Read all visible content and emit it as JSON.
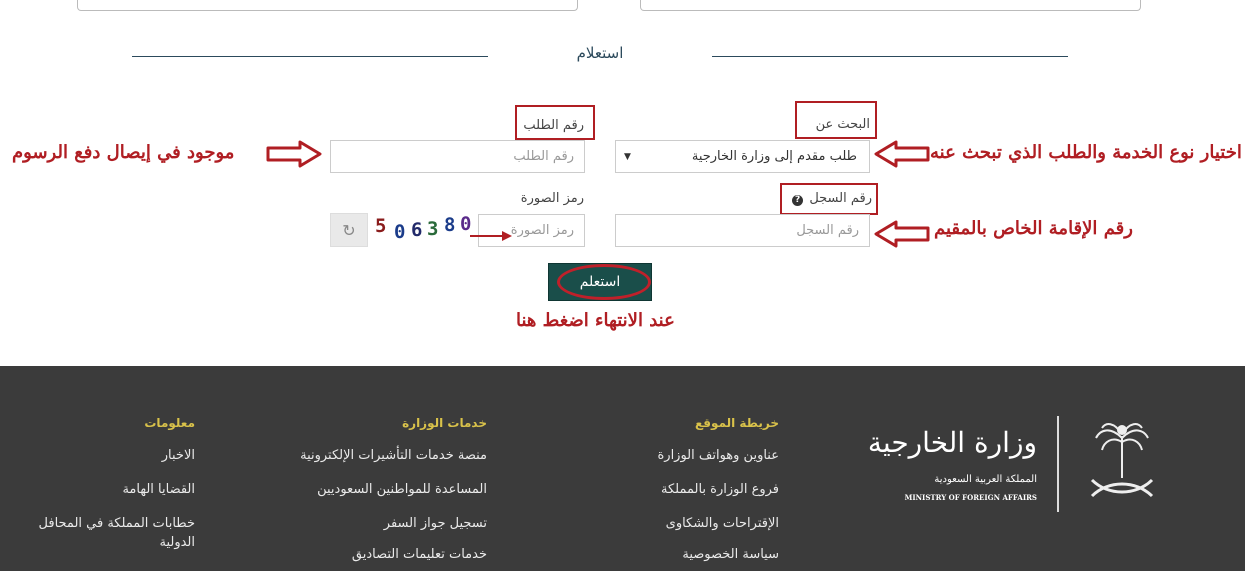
{
  "section": {
    "title": "استعلام"
  },
  "form": {
    "search_by_label": "البحث عن",
    "search_by_value": "طلب مقدم إلى وزارة الخارجية",
    "request_number_label": "رقم الطلب",
    "request_number_placeholder": "رقم الطلب",
    "record_number_label": "رقم السجل",
    "record_number_placeholder": "رقم السجل",
    "captcha_label": "رمز الصورة",
    "captcha_placeholder": "رمز الصورة",
    "captcha_digits": [
      "5",
      "0",
      "6",
      "3",
      "8",
      "0"
    ],
    "submit_label": "استعلم"
  },
  "annotations": {
    "request_number_note": "موجود في إيصال دفع الرسوم",
    "search_by_note": "اختيار نوع الخدمة والطلب الذي تبحث عنه",
    "record_number_note": "رقم الإقامة الخاص بالمقيم",
    "submit_note": "عند الانتهاء اضغط هنا"
  },
  "footer": {
    "sitemap": {
      "heading": "خريطة الموقع",
      "links": [
        "عناوين وهواتف الوزارة",
        "فروع الوزارة بالمملكة",
        "الإقتراحات والشكاوى",
        "سياسة الخصوصية"
      ]
    },
    "services": {
      "heading": "خدمات الوزارة",
      "links": [
        "منصة خدمات التأشيرات الإلكترونية",
        "المساعدة للمواطنين السعوديين",
        "تسجيل جواز السفر",
        "خدمات تعليمات التصاديق"
      ]
    },
    "info": {
      "heading": "معلومات",
      "links": [
        "الاخبار",
        "القضايا الهامة",
        "خطابات المملكة في المحافل الدولية"
      ]
    },
    "logo": {
      "name_ar": "وزارة الخارجية",
      "kingdom_ar": "المملكة العربية السعودية",
      "name_en": "MINISTRY OF FOREIGN AFFAIRS"
    }
  },
  "colors": {
    "accent": "#1a4e4a",
    "annotation": "#b01e23",
    "footer_bg": "#3b3b3b",
    "footer_heading": "#d9c24a"
  }
}
